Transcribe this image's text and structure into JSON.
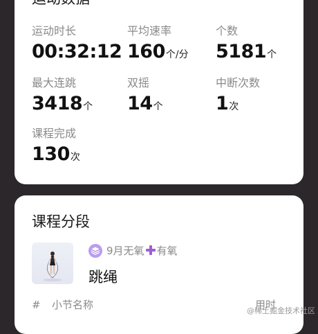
{
  "stats_card": {
    "title": "运动数据",
    "items": [
      {
        "label": "运动时长",
        "value": "00:32:12",
        "unit": ""
      },
      {
        "label": "平均速率",
        "value": "160",
        "unit": "个/分"
      },
      {
        "label": "个数",
        "value": "5181",
        "unit": "个"
      },
      {
        "label": "最大连跳",
        "value": "3418",
        "unit": "个"
      },
      {
        "label": "双摇",
        "value": "14",
        "unit": "个"
      },
      {
        "label": "中断次数",
        "value": "1",
        "unit": "次"
      },
      {
        "label": "课程完成",
        "value": "130",
        "unit": "次"
      }
    ]
  },
  "segments_card": {
    "title": "课程分段",
    "course": {
      "tag_before": "9月无氧",
      "tag_after": "有氧",
      "name": "跳绳",
      "icon": "layers-icon",
      "tag_separator_icon": "plus-icon",
      "thumbnail_icon": "jump-rope-person-icon"
    },
    "table_headers": {
      "index": "#",
      "name": "小节名称",
      "time": "用时"
    }
  },
  "watermark": "@稀土掘金技术社区",
  "colors": {
    "background": "#2b272b",
    "card": "#ffffff",
    "label": "#8a8a8a",
    "value": "#111111",
    "accent_icon": "#b99cf0",
    "plus_icon": "#9c5fd3"
  }
}
